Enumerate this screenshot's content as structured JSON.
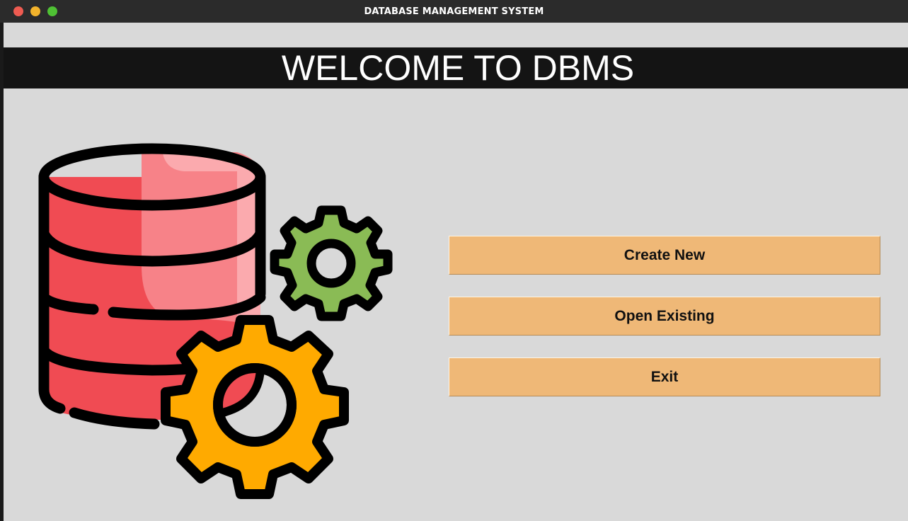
{
  "window": {
    "title": "DATABASE MANAGEMENT SYSTEM"
  },
  "banner": {
    "text": "WELCOME TO DBMS"
  },
  "illustration": {
    "icon": "database-gears-icon",
    "colors": {
      "cylinder": "#f04b53",
      "cylinder_highlight": "#f78288",
      "gear_small": "#8abb55",
      "gear_large": "#ffaa00",
      "outline": "#000000"
    }
  },
  "buttons": {
    "create_new": "Create New",
    "open_existing": "Open Existing",
    "exit": "Exit"
  },
  "colors": {
    "background": "#d9d9d9",
    "banner": "#141414",
    "button": "#efb877"
  }
}
